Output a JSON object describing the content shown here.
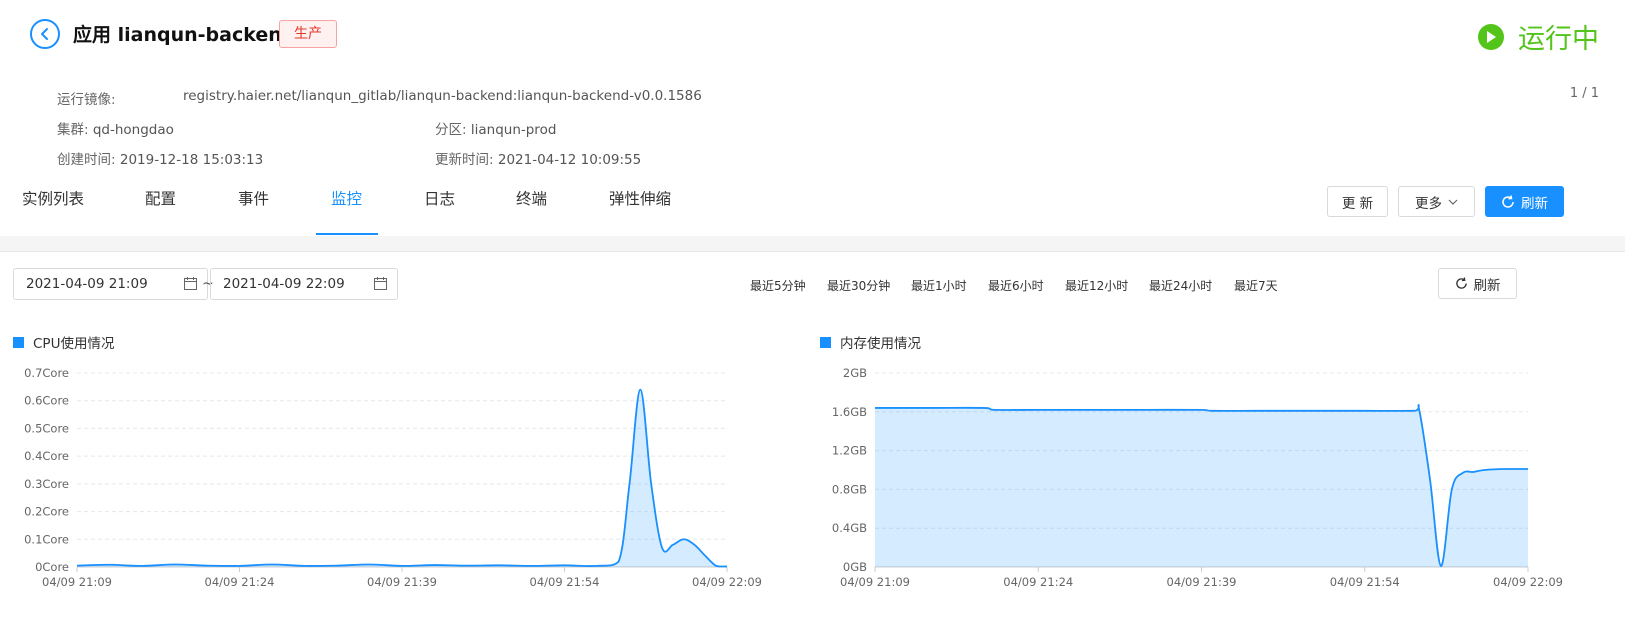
{
  "header": {
    "title": "应用 lianqun-backend",
    "env_badge": "生产",
    "status": "运行中",
    "status_color": "#52c41a"
  },
  "info": {
    "image_label": "运行镜像:",
    "image_value": "registry.haier.net/lianqun_gitlab/lianqun-backend:lianqun-backend-v0.0.1586",
    "cluster_label": "集群:",
    "cluster_value": "qd-hongdao",
    "partition_label": "分区:",
    "partition_value": "lianqun-prod",
    "created_label": "创建时间:",
    "created_value": "2019-12-18 15:03:13",
    "updated_label": "更新时间:",
    "updated_value": "2021-04-12 10:09:55",
    "pager": "1 / 1"
  },
  "tabs": [
    "实例列表",
    "配置",
    "事件",
    "监控",
    "日志",
    "终端",
    "弹性伸缩"
  ],
  "active_tab": "监控",
  "actions": {
    "update": "更 新",
    "more": "更多",
    "refresh": "刷新"
  },
  "monitor": {
    "start_time": "2021-04-09 21:09",
    "end_time": "2021-04-09 22:09",
    "range_sep": "~",
    "ranges": [
      "最近5分钟",
      "最近30分钟",
      "最近1小时",
      "最近6小时",
      "最近12小时",
      "最近24小时",
      "最近7天"
    ],
    "refresh": "刷新"
  },
  "accent_color": "#1890ff",
  "chart_data": [
    {
      "type": "area",
      "title": "CPU使用情况",
      "y_ticks": [
        "0Core",
        "0.1Core",
        "0.2Core",
        "0.3Core",
        "0.4Core",
        "0.5Core",
        "0.6Core",
        "0.7Core"
      ],
      "x_ticks": [
        "04/09 21:09",
        "04/09 21:24",
        "04/09 21:39",
        "04/09 21:54",
        "04/09 22:09"
      ],
      "ylim": [
        0,
        0.7
      ],
      "xlim": [
        0,
        60
      ],
      "unit": "Core",
      "x": [
        0,
        3,
        6,
        9,
        12,
        15,
        18,
        21,
        24,
        27,
        30,
        33,
        36,
        39,
        42,
        45,
        48,
        50,
        51,
        52,
        53,
        54,
        55,
        56,
        57,
        58,
        59,
        60
      ],
      "y": [
        0.005,
        0.008,
        0.004,
        0.009,
        0.005,
        0.004,
        0.009,
        0.004,
        0.005,
        0.009,
        0.004,
        0.007,
        0.005,
        0.006,
        0.004,
        0.006,
        0.004,
        0.02,
        0.3,
        0.64,
        0.3,
        0.07,
        0.08,
        0.1,
        0.08,
        0.04,
        0.004,
        0.002
      ]
    },
    {
      "type": "area",
      "title": "内存使用情况",
      "y_ticks": [
        "0GB",
        "0.4GB",
        "0.8GB",
        "1.2GB",
        "1.6GB",
        "2GB"
      ],
      "x_ticks": [
        "04/09 21:09",
        "04/09 21:24",
        "04/09 21:39",
        "04/09 21:54",
        "04/09 22:09"
      ],
      "ylim": [
        0,
        2
      ],
      "xlim": [
        0,
        60
      ],
      "unit": "GB",
      "x": [
        0,
        5,
        10,
        11,
        15,
        20,
        25,
        30,
        31,
        35,
        40,
        45,
        49.5,
        50,
        51,
        52,
        53,
        54,
        55,
        56,
        58,
        60
      ],
      "y": [
        1.64,
        1.64,
        1.64,
        1.62,
        1.62,
        1.62,
        1.62,
        1.62,
        1.61,
        1.61,
        1.61,
        1.61,
        1.61,
        1.62,
        0.9,
        0.01,
        0.8,
        0.97,
        0.98,
        1.0,
        1.01,
        1.01
      ]
    }
  ]
}
